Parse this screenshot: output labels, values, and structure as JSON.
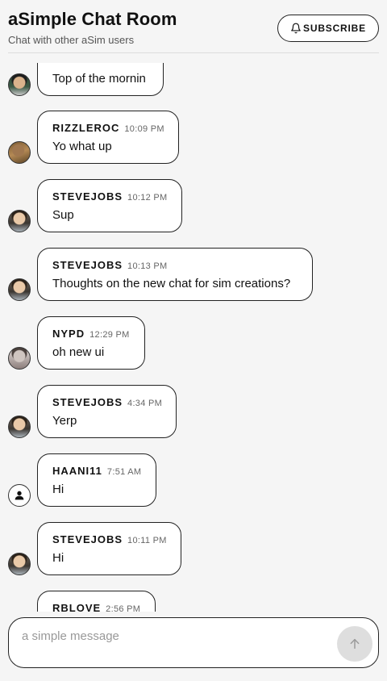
{
  "header": {
    "title": "aSimple Chat Room",
    "subtitle": "Chat with other aSim users",
    "subscribe_label": "SUBSCRIBE",
    "subscribe_icon": "bell-icon"
  },
  "messages": [
    {
      "user": "",
      "time": "",
      "text": "Top of the mornin",
      "avatar": "photo2"
    },
    {
      "user": "RIZZLEROC",
      "time": "10:09 PM",
      "text": "Yo what up",
      "avatar": "photo3"
    },
    {
      "user": "STEVEJOBS",
      "time": "10:12 PM",
      "text": "Sup",
      "avatar": "photo"
    },
    {
      "user": "STEVEJOBS",
      "time": "10:13 PM",
      "text": "Thoughts on the new chat for sim creations?",
      "avatar": "photo"
    },
    {
      "user": "NYPD",
      "time": "12:29 PM",
      "text": "oh new ui",
      "avatar": "photo4"
    },
    {
      "user": "STEVEJOBS",
      "time": "4:34 PM",
      "text": "Yerp",
      "avatar": "photo"
    },
    {
      "user": "HAANI11",
      "time": "7:51 AM",
      "text": "Hi",
      "avatar": "default"
    },
    {
      "user": "STEVEJOBS",
      "time": "10:11 PM",
      "text": "Hi",
      "avatar": "photo"
    },
    {
      "user": "RBLOVE",
      "time": "2:56 PM",
      "text": "",
      "avatar": "photo"
    }
  ],
  "composer": {
    "placeholder": "a simple message",
    "value": "",
    "send_icon": "arrow-up-icon"
  },
  "colors": {
    "background": "#f5f5f5",
    "bubble_border": "#222222",
    "send_button": "#dedede"
  }
}
